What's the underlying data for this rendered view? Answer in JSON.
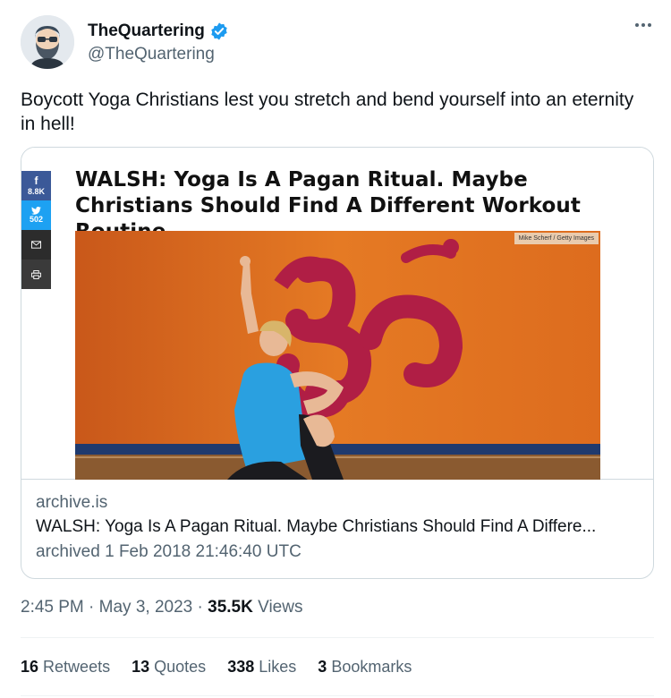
{
  "author": {
    "display_name": "TheQuartering",
    "handle": "@TheQuartering",
    "verified_icon": "verified-badge-icon",
    "avatar_icon": "bearded-man-avatar"
  },
  "tweet": {
    "text": "Boycott Yoga Christians lest you stretch and bend yourself into an eternity in hell!"
  },
  "card": {
    "headline": "WALSH: Yoga Is A Pagan Ritual. Maybe Christians Should Find A Different Workout Routine.",
    "photo_credit": "Mike Scherf / Getty Images",
    "share": {
      "facebook_count": "8.8K",
      "twitter_count": "502"
    },
    "domain": "archive.is",
    "title": "WALSH: Yoga Is A Pagan Ritual. Maybe Christians Should Find A Differe...",
    "description": "archived 1 Feb 2018 21:46:40 UTC"
  },
  "meta": {
    "time": "2:45 PM",
    "separator": "·",
    "date": "May 3, 2023",
    "views_count": "35.5K",
    "views_label": "Views"
  },
  "stats": {
    "retweets_count": "16",
    "retweets_label": "Retweets",
    "quotes_count": "13",
    "quotes_label": "Quotes",
    "likes_count": "338",
    "likes_label": "Likes",
    "bookmarks_count": "3",
    "bookmarks_label": "Bookmarks"
  },
  "colors": {
    "verified": "#1d9bf0",
    "secondary_text": "#536471",
    "photo_orange": "#d9691d",
    "om_symbol": "#b01e45"
  }
}
